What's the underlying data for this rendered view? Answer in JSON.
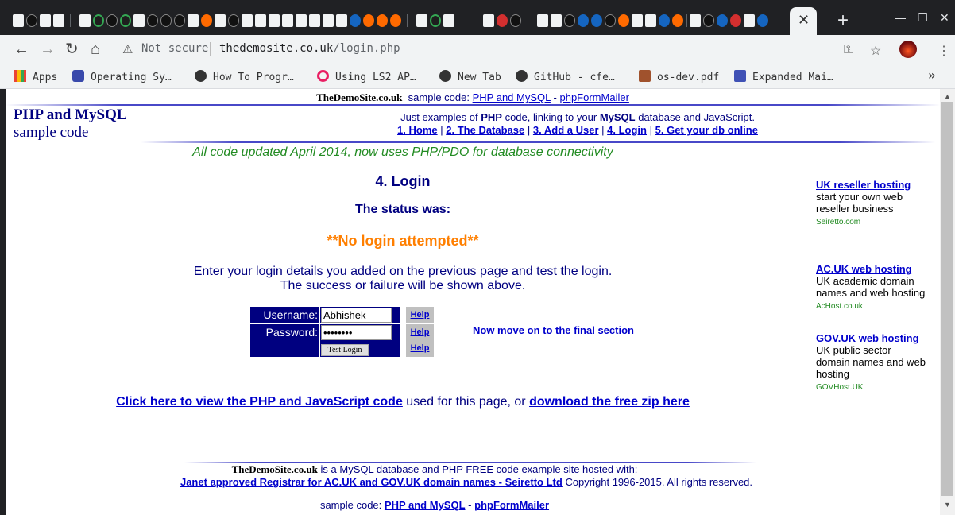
{
  "browser": {
    "tab_close": "✕",
    "new_tab": "+",
    "not_secure": "Not secure",
    "url_host": "thedemosite.co.uk",
    "url_path": "/login.php",
    "bookmarks": [
      "Apps",
      "Operating Sy…",
      "How To Progr…",
      "Using LS2 AP…",
      "New Tab",
      "GitHub - cfe…",
      "os-dev.pdf",
      "Expanded Mai…"
    ],
    "more_bookmarks": "»"
  },
  "site": {
    "brand": "TheDemoSite.co.uk",
    "sample_code_label": "sample code:",
    "link_php_mysql": "PHP and MySQL",
    "dash": "-",
    "link_phpformmailer": "phpFormMailer",
    "title_line1": "PHP and MySQL",
    "title_line2": "sample code",
    "intro_a": "Just examples of ",
    "intro_php": "PHP",
    "intro_b": " code, linking to your ",
    "intro_mysql": "MySQL",
    "intro_c": " database and JavaScript.",
    "nav": [
      "1. Home",
      "2. The Database",
      "3. Add a User",
      "4. Login",
      "5. Get your db online"
    ],
    "nav_sep": "|",
    "updated": "All code updated April 2014, now uses PHP/PDO for database connectivity"
  },
  "main": {
    "heading": "4. Login",
    "status_label": "The status was:",
    "status_value": "**No login attempted**",
    "instructions_line1": "Enter your login details you added on the previous page and test the login.",
    "instructions_line2": "The success or failure will be shown above.",
    "username_label": "Username:",
    "username_value": "Abhishek",
    "password_label": "Password:",
    "password_value": "password",
    "help_label": "Help",
    "button_label": "Test Login",
    "move_on": "Now move on to the final section",
    "code_link": "Click here to view the PHP and JavaScript code",
    "code_mid": " used for this page, or ",
    "zip_link": "download the free zip here"
  },
  "sidebar": [
    {
      "link": "UK reseller hosting",
      "text": "start your own web reseller business",
      "source": "Seiretto.com"
    },
    {
      "link": "AC.UK web hosting",
      "text": "UK academic domain names and web hosting",
      "source": "AcHost.co.uk"
    },
    {
      "link": "GOV.UK web hosting",
      "text": "UK public sector domain names and web hosting",
      "source": "GOVHost.UK"
    }
  ],
  "footer": {
    "hosted_text": " is a MySQL database and PHP FREE code example site hosted with:",
    "registrar_link": "Janet approved Registrar for AC.UK and GOV.UK domain names - Seiretto Ltd",
    "copyright": " Copyright 1996-2015.  All rights reserved."
  }
}
